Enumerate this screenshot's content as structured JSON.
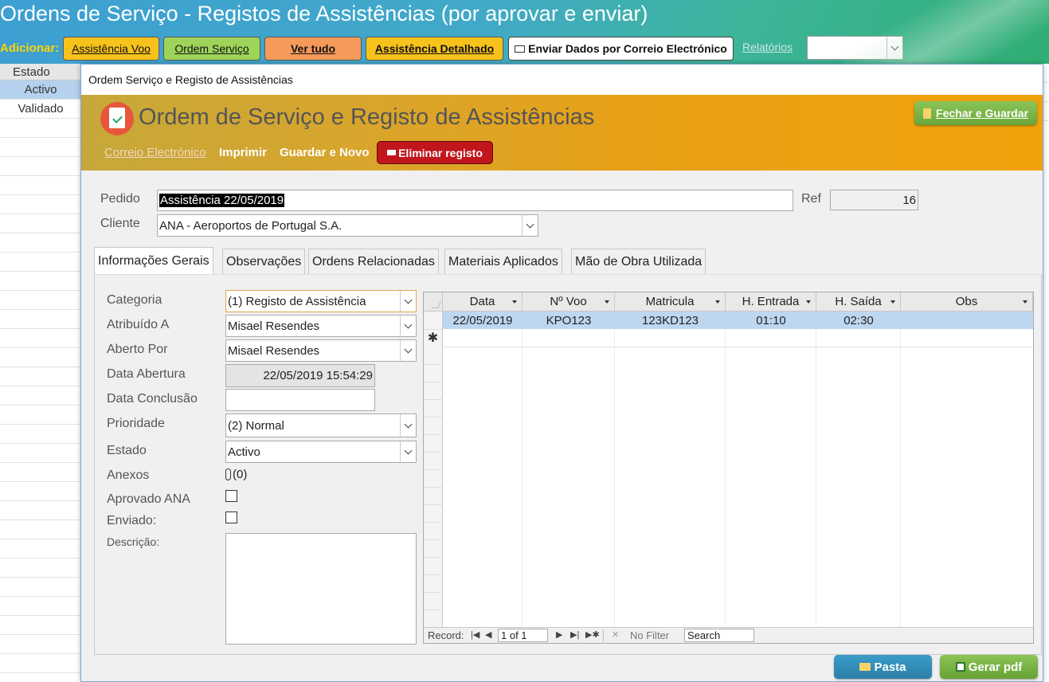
{
  "app": {
    "title": "Ordens de Serviço - Registos de Assistências (por aprovar e enviar)",
    "add_label": "Adicionar:",
    "toolbar": {
      "assistencia_voo": "Assistência Voo",
      "ordem_servico": "Ordem Serviço",
      "ver_tudo": "Ver tudo",
      "assistencia_detalhado": "Assistência Detalhado",
      "enviar_email": "Enviar Dados por Correio Electrónico",
      "relatorios": "Relatórios"
    },
    "list": {
      "header": "Estado",
      "rows": [
        "Activo",
        "Validado"
      ]
    }
  },
  "popup": {
    "window_title": "Ordem Serviço e Registo de Assistências",
    "banner": {
      "title": "Ordem de Serviço e Registo de Assistências",
      "link_email": "Correio Electrónico",
      "link_print": "Imprimir",
      "link_save_new": "Guardar e Novo",
      "delete": "Eliminar registo",
      "close_save": "Fechar e Guardar"
    },
    "pedido": {
      "label": "Pedido",
      "value": "Assistência 22/05/2019"
    },
    "ref": {
      "label": "Ref",
      "value": "16"
    },
    "cliente": {
      "label": "Cliente",
      "value": "ANA - Aeroportos de Portugal S.A."
    },
    "tabs": [
      "Informações Gerais",
      "Observações",
      "Ordens Relacionadas",
      "Materiais Aplicados",
      "Mão de Obra Utilizada"
    ],
    "form": {
      "categoria": {
        "label": "Categoria",
        "value": "(1) Registo de Assistência"
      },
      "atribuido": {
        "label": "Atribuído A",
        "value": "Misael Resendes"
      },
      "aberto": {
        "label": "Aberto Por",
        "value": "Misael Resendes"
      },
      "data_abertura": {
        "label": "Data Abertura",
        "value": "22/05/2019 15:54:29"
      },
      "data_conclusao": {
        "label": "Data Conclusão",
        "value": ""
      },
      "prioridade": {
        "label": "Prioridade",
        "value": "(2) Normal"
      },
      "estado": {
        "label": "Estado",
        "value": "Activo"
      },
      "anexos": {
        "label": "Anexos",
        "value": "(0)"
      },
      "aprovado": {
        "label": "Aprovado ANA",
        "checked": false
      },
      "enviado": {
        "label": "Enviado:",
        "checked": false
      },
      "descricao": {
        "label": "Descrição:",
        "value": ""
      }
    },
    "grid": {
      "columns": [
        "Data",
        "Nº Voo",
        "Matricula",
        "H. Entrada",
        "H. Saída",
        "Obs"
      ],
      "rows": [
        [
          "22/05/2019",
          "KPO123",
          "123KD123",
          "01:10",
          "02:30",
          ""
        ]
      ],
      "nav": {
        "record_label": "Record:",
        "position": "1 of 1",
        "filter": "No Filter",
        "search": "Search"
      }
    },
    "buttons": {
      "pasta": "Pasta",
      "gerar_pdf": "Gerar pdf"
    }
  }
}
